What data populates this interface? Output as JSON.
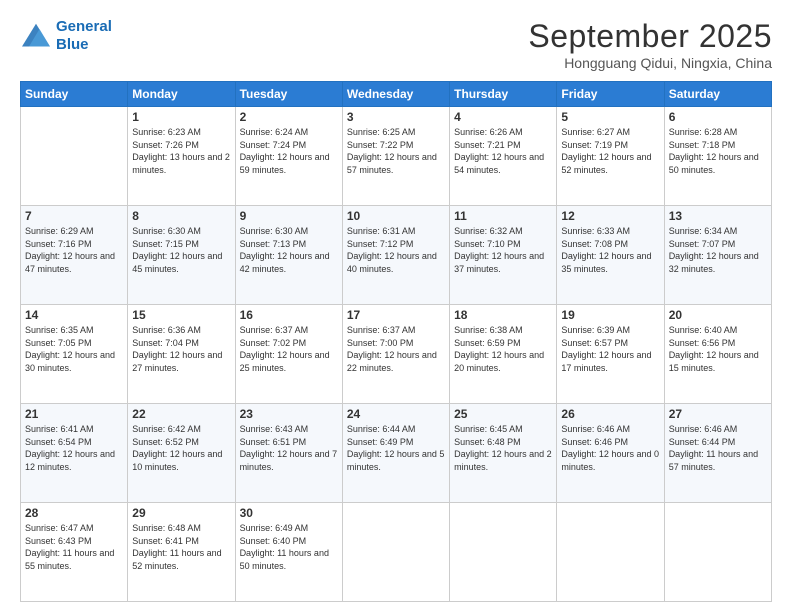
{
  "header": {
    "logo": {
      "line1": "General",
      "line2": "Blue"
    },
    "title": "September 2025",
    "subtitle": "Hongguang Qidui, Ningxia, China"
  },
  "weekdays": [
    "Sunday",
    "Monday",
    "Tuesday",
    "Wednesday",
    "Thursday",
    "Friday",
    "Saturday"
  ],
  "weeks": [
    [
      {
        "day": "",
        "sunrise": "",
        "sunset": "",
        "daylight": ""
      },
      {
        "day": "1",
        "sunrise": "Sunrise: 6:23 AM",
        "sunset": "Sunset: 7:26 PM",
        "daylight": "Daylight: 13 hours and 2 minutes."
      },
      {
        "day": "2",
        "sunrise": "Sunrise: 6:24 AM",
        "sunset": "Sunset: 7:24 PM",
        "daylight": "Daylight: 12 hours and 59 minutes."
      },
      {
        "day": "3",
        "sunrise": "Sunrise: 6:25 AM",
        "sunset": "Sunset: 7:22 PM",
        "daylight": "Daylight: 12 hours and 57 minutes."
      },
      {
        "day": "4",
        "sunrise": "Sunrise: 6:26 AM",
        "sunset": "Sunset: 7:21 PM",
        "daylight": "Daylight: 12 hours and 54 minutes."
      },
      {
        "day": "5",
        "sunrise": "Sunrise: 6:27 AM",
        "sunset": "Sunset: 7:19 PM",
        "daylight": "Daylight: 12 hours and 52 minutes."
      },
      {
        "day": "6",
        "sunrise": "Sunrise: 6:28 AM",
        "sunset": "Sunset: 7:18 PM",
        "daylight": "Daylight: 12 hours and 50 minutes."
      }
    ],
    [
      {
        "day": "7",
        "sunrise": "Sunrise: 6:29 AM",
        "sunset": "Sunset: 7:16 PM",
        "daylight": "Daylight: 12 hours and 47 minutes."
      },
      {
        "day": "8",
        "sunrise": "Sunrise: 6:30 AM",
        "sunset": "Sunset: 7:15 PM",
        "daylight": "Daylight: 12 hours and 45 minutes."
      },
      {
        "day": "9",
        "sunrise": "Sunrise: 6:30 AM",
        "sunset": "Sunset: 7:13 PM",
        "daylight": "Daylight: 12 hours and 42 minutes."
      },
      {
        "day": "10",
        "sunrise": "Sunrise: 6:31 AM",
        "sunset": "Sunset: 7:12 PM",
        "daylight": "Daylight: 12 hours and 40 minutes."
      },
      {
        "day": "11",
        "sunrise": "Sunrise: 6:32 AM",
        "sunset": "Sunset: 7:10 PM",
        "daylight": "Daylight: 12 hours and 37 minutes."
      },
      {
        "day": "12",
        "sunrise": "Sunrise: 6:33 AM",
        "sunset": "Sunset: 7:08 PM",
        "daylight": "Daylight: 12 hours and 35 minutes."
      },
      {
        "day": "13",
        "sunrise": "Sunrise: 6:34 AM",
        "sunset": "Sunset: 7:07 PM",
        "daylight": "Daylight: 12 hours and 32 minutes."
      }
    ],
    [
      {
        "day": "14",
        "sunrise": "Sunrise: 6:35 AM",
        "sunset": "Sunset: 7:05 PM",
        "daylight": "Daylight: 12 hours and 30 minutes."
      },
      {
        "day": "15",
        "sunrise": "Sunrise: 6:36 AM",
        "sunset": "Sunset: 7:04 PM",
        "daylight": "Daylight: 12 hours and 27 minutes."
      },
      {
        "day": "16",
        "sunrise": "Sunrise: 6:37 AM",
        "sunset": "Sunset: 7:02 PM",
        "daylight": "Daylight: 12 hours and 25 minutes."
      },
      {
        "day": "17",
        "sunrise": "Sunrise: 6:37 AM",
        "sunset": "Sunset: 7:00 PM",
        "daylight": "Daylight: 12 hours and 22 minutes."
      },
      {
        "day": "18",
        "sunrise": "Sunrise: 6:38 AM",
        "sunset": "Sunset: 6:59 PM",
        "daylight": "Daylight: 12 hours and 20 minutes."
      },
      {
        "day": "19",
        "sunrise": "Sunrise: 6:39 AM",
        "sunset": "Sunset: 6:57 PM",
        "daylight": "Daylight: 12 hours and 17 minutes."
      },
      {
        "day": "20",
        "sunrise": "Sunrise: 6:40 AM",
        "sunset": "Sunset: 6:56 PM",
        "daylight": "Daylight: 12 hours and 15 minutes."
      }
    ],
    [
      {
        "day": "21",
        "sunrise": "Sunrise: 6:41 AM",
        "sunset": "Sunset: 6:54 PM",
        "daylight": "Daylight: 12 hours and 12 minutes."
      },
      {
        "day": "22",
        "sunrise": "Sunrise: 6:42 AM",
        "sunset": "Sunset: 6:52 PM",
        "daylight": "Daylight: 12 hours and 10 minutes."
      },
      {
        "day": "23",
        "sunrise": "Sunrise: 6:43 AM",
        "sunset": "Sunset: 6:51 PM",
        "daylight": "Daylight: 12 hours and 7 minutes."
      },
      {
        "day": "24",
        "sunrise": "Sunrise: 6:44 AM",
        "sunset": "Sunset: 6:49 PM",
        "daylight": "Daylight: 12 hours and 5 minutes."
      },
      {
        "day": "25",
        "sunrise": "Sunrise: 6:45 AM",
        "sunset": "Sunset: 6:48 PM",
        "daylight": "Daylight: 12 hours and 2 minutes."
      },
      {
        "day": "26",
        "sunrise": "Sunrise: 6:46 AM",
        "sunset": "Sunset: 6:46 PM",
        "daylight": "Daylight: 12 hours and 0 minutes."
      },
      {
        "day": "27",
        "sunrise": "Sunrise: 6:46 AM",
        "sunset": "Sunset: 6:44 PM",
        "daylight": "Daylight: 11 hours and 57 minutes."
      }
    ],
    [
      {
        "day": "28",
        "sunrise": "Sunrise: 6:47 AM",
        "sunset": "Sunset: 6:43 PM",
        "daylight": "Daylight: 11 hours and 55 minutes."
      },
      {
        "day": "29",
        "sunrise": "Sunrise: 6:48 AM",
        "sunset": "Sunset: 6:41 PM",
        "daylight": "Daylight: 11 hours and 52 minutes."
      },
      {
        "day": "30",
        "sunrise": "Sunrise: 6:49 AM",
        "sunset": "Sunset: 6:40 PM",
        "daylight": "Daylight: 11 hours and 50 minutes."
      },
      {
        "day": "",
        "sunrise": "",
        "sunset": "",
        "daylight": ""
      },
      {
        "day": "",
        "sunrise": "",
        "sunset": "",
        "daylight": ""
      },
      {
        "day": "",
        "sunrise": "",
        "sunset": "",
        "daylight": ""
      },
      {
        "day": "",
        "sunrise": "",
        "sunset": "",
        "daylight": ""
      }
    ]
  ]
}
